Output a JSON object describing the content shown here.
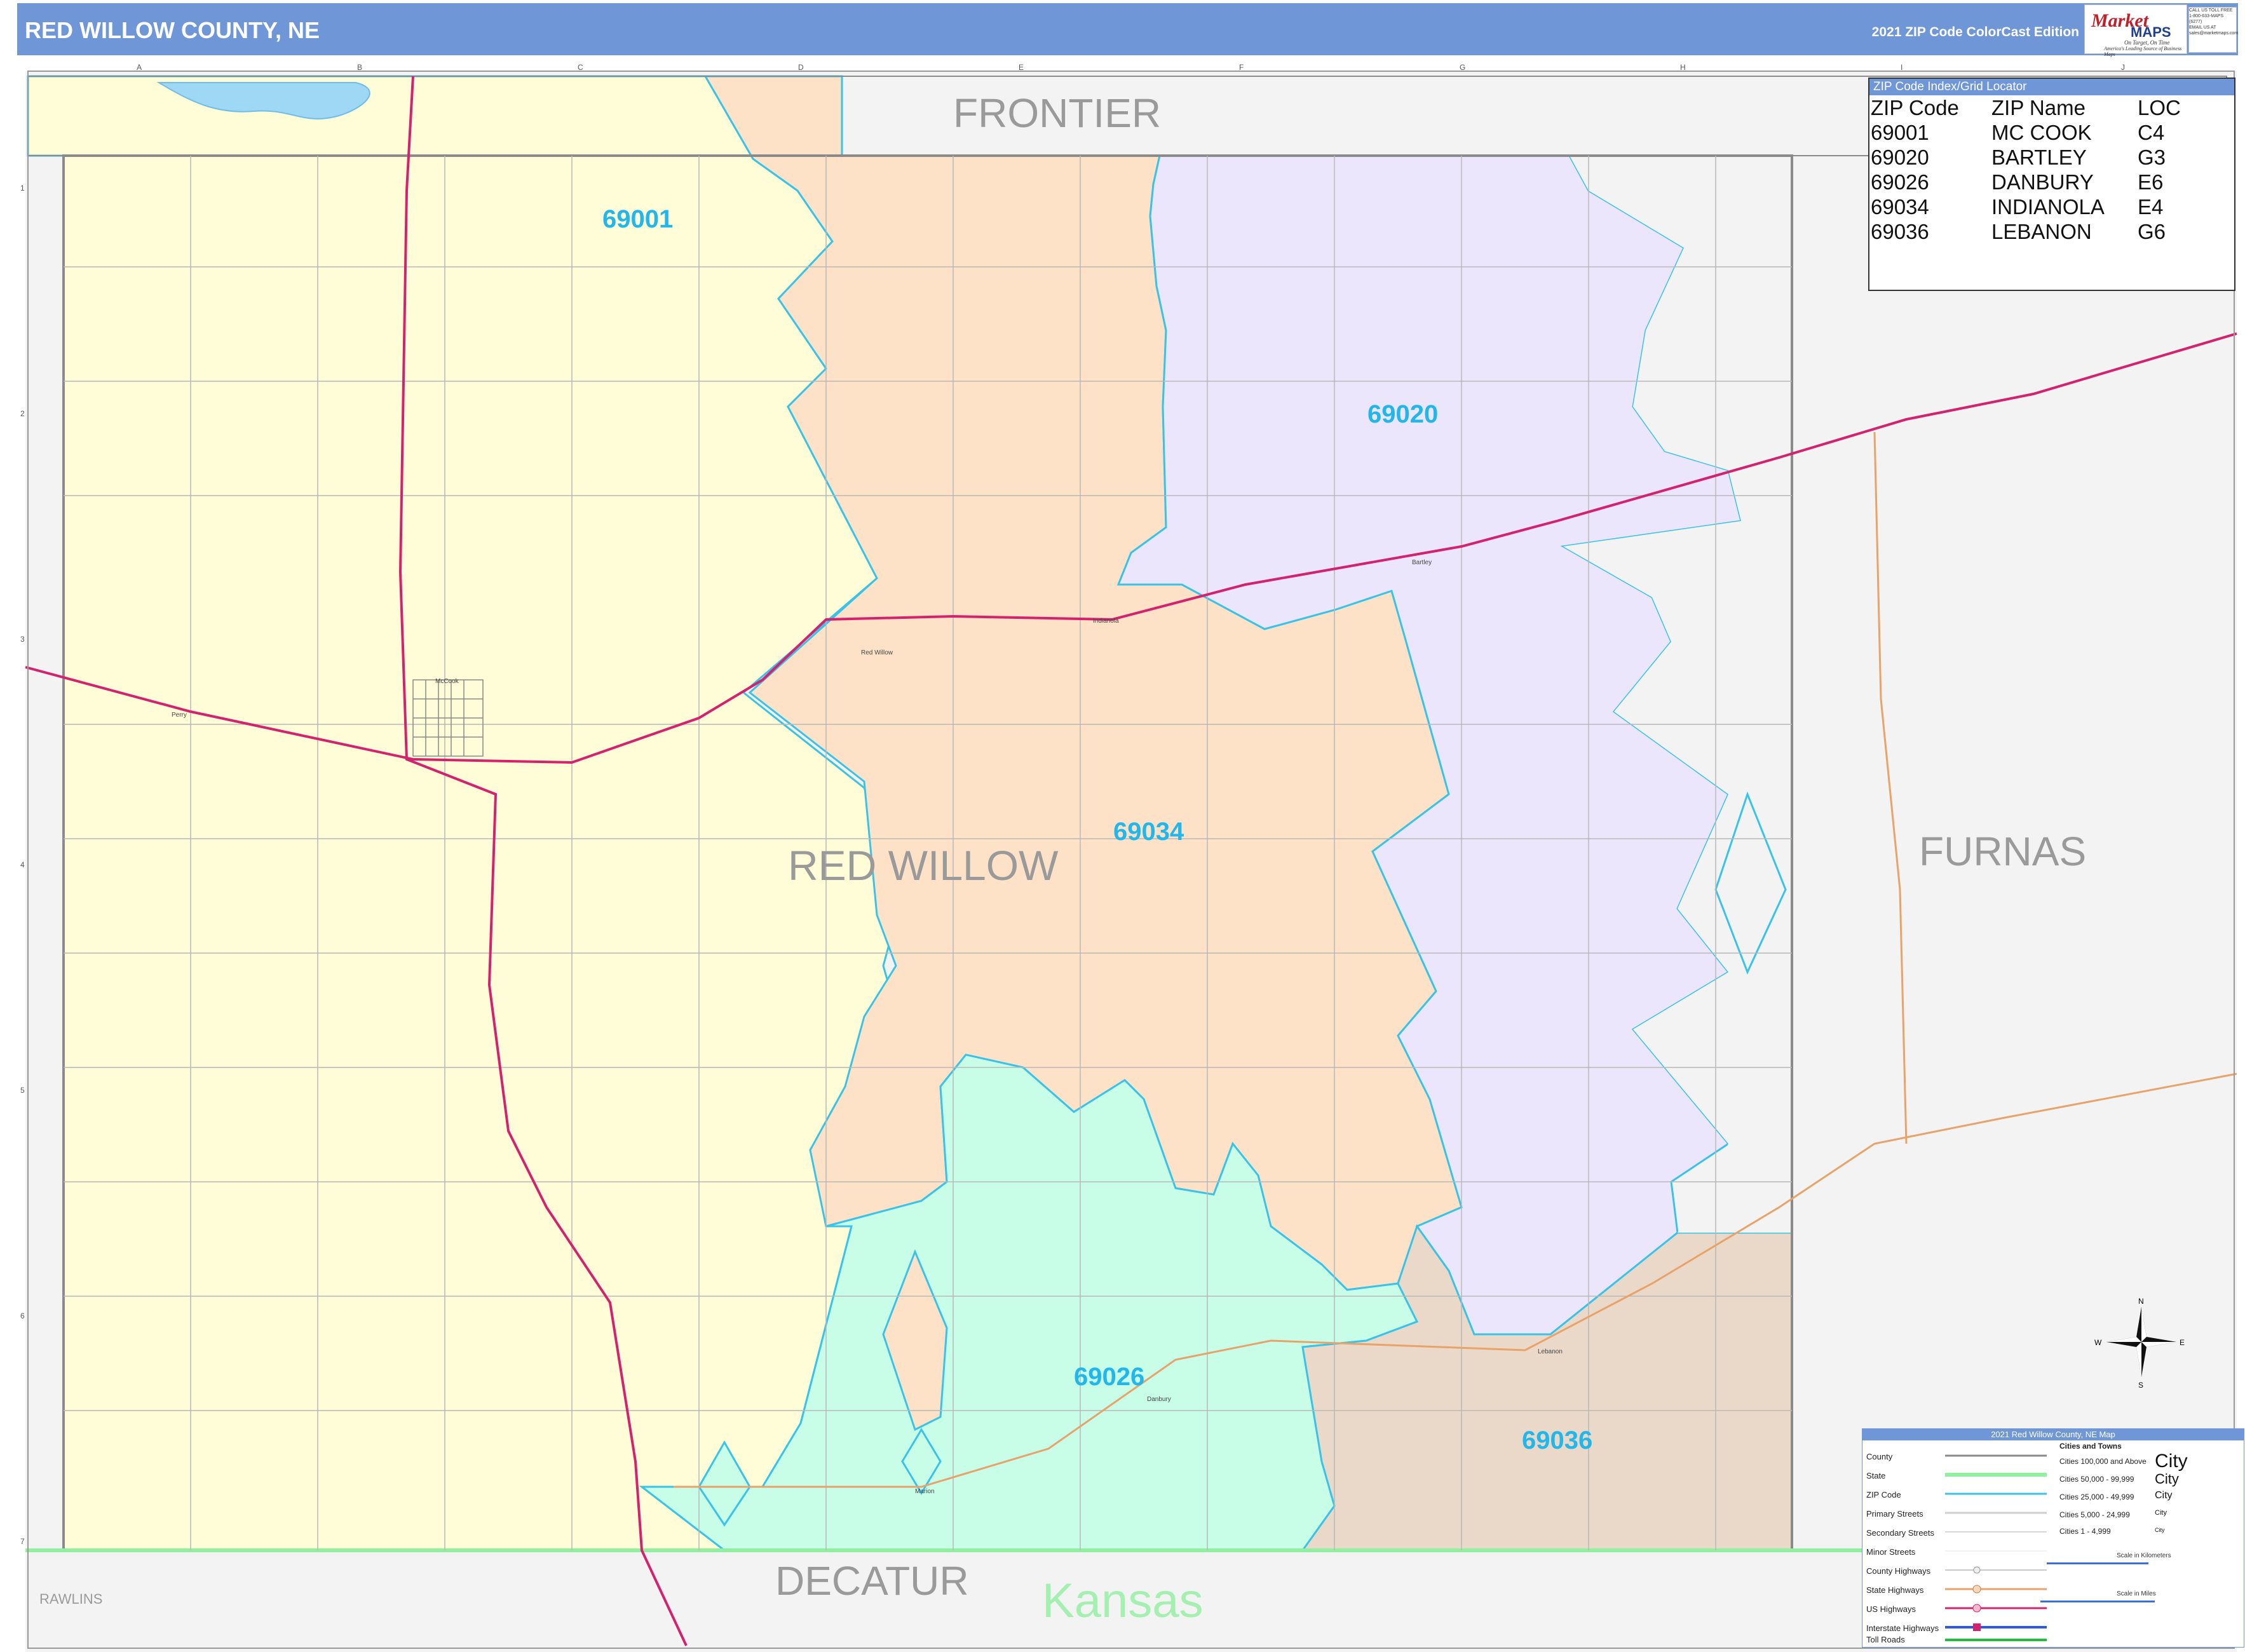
{
  "header": {
    "title": "RED WILLOW COUNTY, NE",
    "edition": "2021 ZIP Code ColorCast Edition",
    "logo_market": "Market",
    "logo_maps": "MAPS",
    "logo_tagline": "On Target, On Time",
    "logo_subtag": "America's Leading Source of Business Maps",
    "contact_lines": [
      "CALL US TOLL FREE",
      "1-800-633-MAPS (6277)",
      "EMAIL US AT",
      "sales@marketmaps.com"
    ]
  },
  "colors": {
    "header_bg": "#6f97d8",
    "zip_69001": "#fffdd8",
    "zip_69034": "#fde2c8",
    "zip_69020": "#ece6fc",
    "zip_69026": "#c8fde8",
    "zip_69036": "#ead9c8",
    "outside": "#f3f3f3",
    "zip_boundary": "#39c3e8",
    "us_highway": "#d4226e",
    "state_highway": "#e8a36a",
    "zip_label": "#22b7ea",
    "county_label": "#9a9a9a",
    "kansas_label": "#a4f0b0"
  },
  "grid": {
    "columns": [
      "A",
      "B",
      "C",
      "D",
      "E",
      "F",
      "G",
      "H",
      "I",
      "J"
    ],
    "rows": [
      "1",
      "2",
      "3",
      "4",
      "5",
      "6",
      "7"
    ]
  },
  "map": {
    "county_labels": [
      {
        "id": "frontier",
        "text": "FRONTIER"
      },
      {
        "id": "red-willow",
        "text": "RED WILLOW"
      },
      {
        "id": "furnas",
        "text": "FURNAS"
      },
      {
        "id": "decatur",
        "text": "DECATUR"
      },
      {
        "id": "rawlins",
        "text": "RAWLINS"
      }
    ],
    "state_label": "Kansas",
    "zip_labels": [
      {
        "zip": "69001"
      },
      {
        "zip": "69020"
      },
      {
        "zip": "69034"
      },
      {
        "zip": "69026"
      },
      {
        "zip": "69036"
      }
    ],
    "towns": [
      "McCook",
      "Red Willow",
      "Indianola",
      "Bartley",
      "Danbury",
      "Lebanon",
      "Marion",
      "Perry"
    ]
  },
  "zip_index": {
    "header": "ZIP Code Index/Grid Locator",
    "columns": [
      "ZIP Code",
      "ZIP Name",
      "LOC"
    ],
    "rows": [
      [
        "69001",
        "MC COOK",
        "C4"
      ],
      [
        "69020",
        "BARTLEY",
        "G3"
      ],
      [
        "69026",
        "DANBURY",
        "E6"
      ],
      [
        "69034",
        "INDIANOLA",
        "E4"
      ],
      [
        "69036",
        "LEBANON",
        "G6"
      ]
    ]
  },
  "legend": {
    "title": "2021 Red Willow County, NE Map",
    "items": [
      "County",
      "State",
      "ZIP Code",
      "Primary Streets",
      "Secondary Streets",
      "Minor Streets",
      "County Highways",
      "State Highways",
      "US Highways",
      "Interstate Highways",
      "Toll Roads"
    ],
    "cities_header": "Cities and Towns",
    "city_classes": [
      {
        "range": "Cities 100,000 and Above",
        "sample": "City"
      },
      {
        "range": "Cities 50,000 - 99,999",
        "sample": "City"
      },
      {
        "range": "Cities 25,000 - 49,999",
        "sample": "City"
      },
      {
        "range": "Cities 5,000 - 24,999",
        "sample": "City"
      },
      {
        "range": "Cities 1 - 4,999",
        "sample": "City"
      }
    ],
    "scale_km": "Scale in Kilometers",
    "scale_mi": "Scale in Miles"
  },
  "compass": {
    "n": "N",
    "s": "S",
    "e": "E",
    "w": "W"
  }
}
